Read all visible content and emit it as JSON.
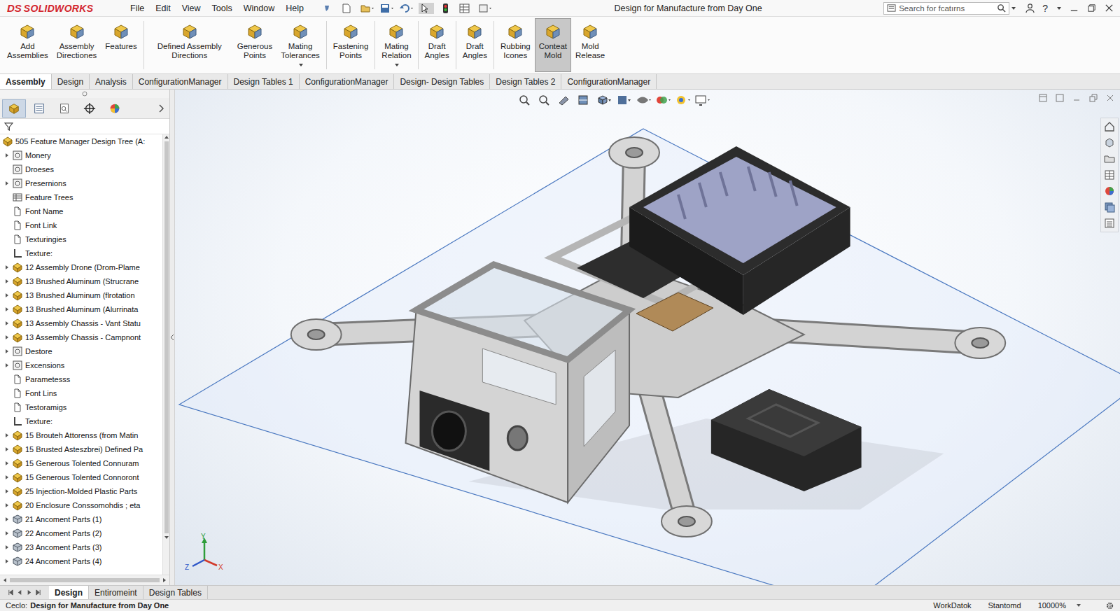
{
  "window": {
    "title": "Design for Manufacture from Day One"
  },
  "logo": {
    "mark": "DS",
    "name": "SOLIDWORKS"
  },
  "menu": [
    "File",
    "Edit",
    "View",
    "Tools",
    "Window",
    "Help"
  ],
  "search": {
    "placeholder": "Search for fcatırns"
  },
  "help": "?",
  "ribbon": [
    {
      "label": "Add Assemblies",
      "selected": false,
      "dropdown": false,
      "separator_after": false
    },
    {
      "label": "Assembly Directiones",
      "selected": false,
      "dropdown": false,
      "separator_after": false
    },
    {
      "label": "Features",
      "selected": false,
      "dropdown": false,
      "separator_after": true
    },
    {
      "label": "Defined Assembly Directions",
      "selected": false,
      "dropdown": false,
      "separator_after": false
    },
    {
      "label": "Generous Points",
      "selected": false,
      "dropdown": false,
      "separator_after": false
    },
    {
      "label": "Mating Tolerances",
      "selected": false,
      "dropdown": true,
      "separator_after": true
    },
    {
      "label": "Fastening Points",
      "selected": false,
      "dropdown": false,
      "separator_after": true
    },
    {
      "label": "Mating Relation",
      "selected": false,
      "dropdown": true,
      "separator_after": true
    },
    {
      "label": "Draft Angles",
      "selected": false,
      "dropdown": false,
      "separator_after": true
    },
    {
      "label": "Draft Angles",
      "selected": false,
      "dropdown": false,
      "separator_after": true
    },
    {
      "label": "Rubbing Icones",
      "selected": false,
      "dropdown": false,
      "separator_after": false
    },
    {
      "label": "Conteat Mold",
      "selected": true,
      "dropdown": false,
      "separator_after": false
    },
    {
      "label": "Mold Release",
      "selected": false,
      "dropdown": false,
      "separator_after": false
    }
  ],
  "tabs": [
    {
      "label": "Assembly",
      "selected": true
    },
    {
      "label": "Design",
      "selected": false
    },
    {
      "label": "Analysis",
      "selected": false
    },
    {
      "label": "ConfigurationManager",
      "selected": false
    },
    {
      "label": "Design Tables 1",
      "selected": false
    },
    {
      "label": "ConfigurationManager",
      "selected": false
    },
    {
      "label": "Design- Design Tables",
      "selected": false
    },
    {
      "label": "Design Tables 2",
      "selected": false
    },
    {
      "label": "ConfigurationManager",
      "selected": false
    }
  ],
  "panel_tabs": [
    {
      "selected": true
    },
    {
      "selected": false
    },
    {
      "selected": false
    },
    {
      "selected": false
    },
    {
      "selected": false
    }
  ],
  "tree": {
    "root": "505 Feature Manager Design Tree (A:",
    "items": [
      {
        "label": "Monery",
        "kind": "feature",
        "expandable": true
      },
      {
        "label": "Droeses",
        "kind": "feature",
        "expandable": false
      },
      {
        "label": "Presernions",
        "kind": "feature",
        "expandable": true
      },
      {
        "label": "Feature Trees",
        "kind": "table",
        "expandable": false
      },
      {
        "label": "Font Name",
        "kind": "page",
        "expandable": false
      },
      {
        "label": "Font Link",
        "kind": "page",
        "expandable": false
      },
      {
        "label": "Texturingies",
        "kind": "page",
        "expandable": false
      },
      {
        "label": "Texture:",
        "kind": "texture",
        "expandable": false
      },
      {
        "label": "12 Assembly Drone (Drom-Plame",
        "kind": "assembly",
        "expandable": true
      },
      {
        "label": "13 Brushed Aluminum (Strucrane",
        "kind": "assembly",
        "expandable": true
      },
      {
        "label": "13 Brushed Aluminum (flrotation",
        "kind": "assembly",
        "expandable": true
      },
      {
        "label": "13 Brushed Aluminum (Alurrinata",
        "kind": "assembly",
        "expandable": true
      },
      {
        "label": "13 Assembly Chassis - Vant Statu",
        "kind": "assembly",
        "expandable": true
      },
      {
        "label": "13 Assembly Chassis - Campnont",
        "kind": "assembly",
        "expandable": true
      },
      {
        "label": "Destore",
        "kind": "feature",
        "expandable": true
      },
      {
        "label": "Excensions",
        "kind": "feature",
        "expandable": true
      },
      {
        "label": "Parametesss",
        "kind": "page",
        "expandable": false
      },
      {
        "label": "Font Lins",
        "kind": "page",
        "expandable": false
      },
      {
        "label": "Testoramigs",
        "kind": "page",
        "expandable": false
      },
      {
        "label": "Texture:",
        "kind": "texture",
        "expandable": false
      },
      {
        "label": "15 Brouteh Attorenss (from Matin",
        "kind": "assembly",
        "expandable": true
      },
      {
        "label": "15 Brusted Asteszbrei) Defined Pa",
        "kind": "assembly",
        "expandable": true
      },
      {
        "label": "15 Generous Tolented Connuram",
        "kind": "assembly",
        "expandable": true
      },
      {
        "label": "15 Generous Tolented Connoront",
        "kind": "assembly",
        "expandable": true
      },
      {
        "label": "25 Injection-Molded Plastic Parts",
        "kind": "assembly",
        "expandable": true
      },
      {
        "label": "20 Enclosure Conssomohdis ; eta",
        "kind": "assembly",
        "expandable": true
      },
      {
        "label": "21 Ancoment Parts (1)",
        "kind": "part",
        "expandable": true
      },
      {
        "label": "22 Ancoment Parts (2)",
        "kind": "part",
        "expandable": true
      },
      {
        "label": "23 Ancoment Parts (3)",
        "kind": "part",
        "expandable": true
      },
      {
        "label": "24 Ancoment Parts (4)",
        "kind": "part",
        "expandable": true
      }
    ]
  },
  "triad": {
    "x": "X",
    "y": "Y",
    "z": "Z"
  },
  "bottom_tabs": [
    {
      "label": "Design",
      "selected": true
    },
    {
      "label": "Entiromeint",
      "selected": false
    },
    {
      "label": "Design Tables",
      "selected": false
    }
  ],
  "status_bar": {
    "label": "Ceclo:",
    "document": "Design for Manufacture from Day One",
    "items": [
      "WorkDatok",
      "Stantomd",
      "10000%"
    ]
  }
}
